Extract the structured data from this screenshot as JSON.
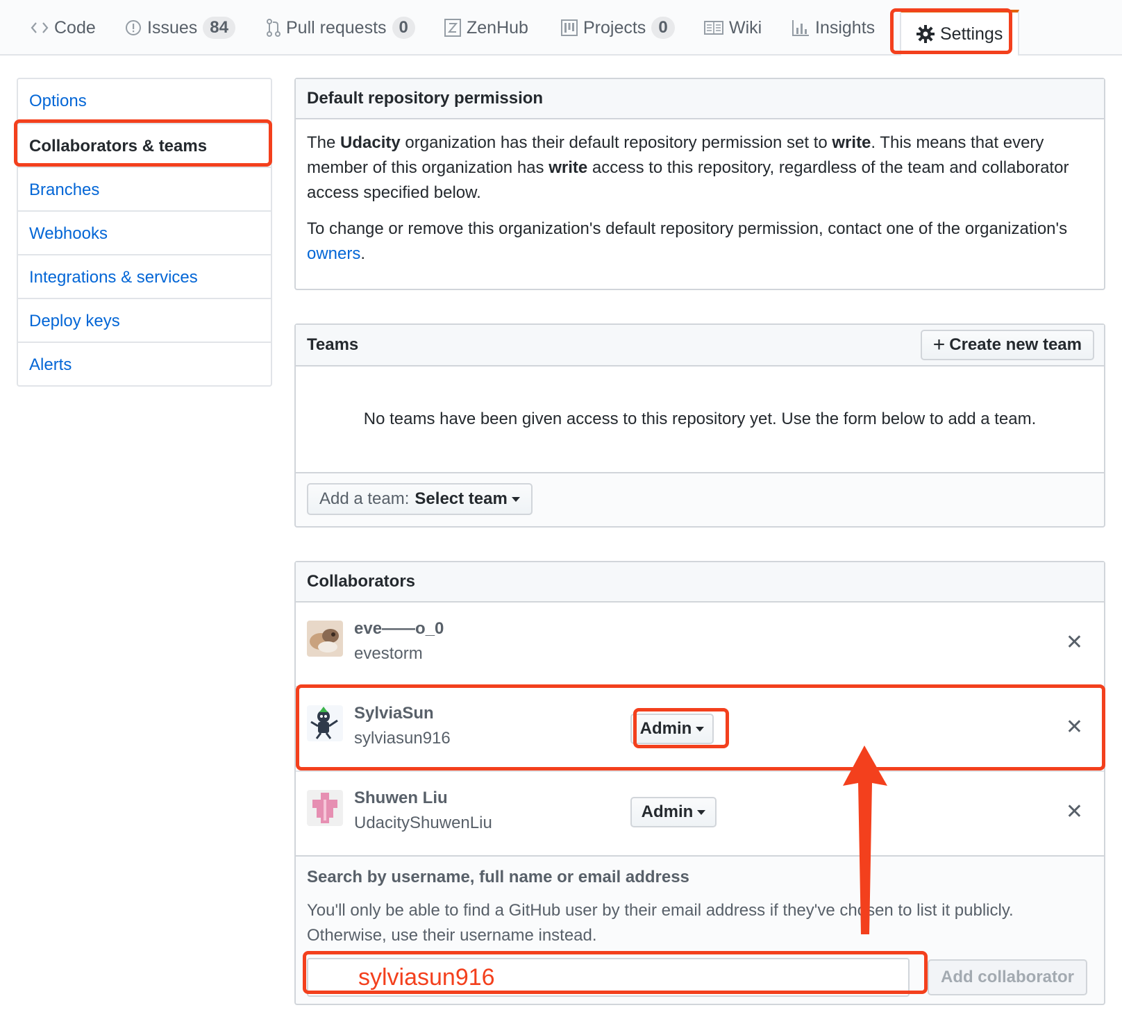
{
  "nav": {
    "tabs": [
      {
        "label": "Code",
        "icon": "code-icon"
      },
      {
        "label": "Issues",
        "icon": "issue-icon",
        "counter": "84"
      },
      {
        "label": "Pull requests",
        "icon": "pull-request-icon",
        "counter": "0"
      },
      {
        "label": "ZenHub",
        "icon": "zenhub-icon"
      },
      {
        "label": "Projects",
        "icon": "project-icon",
        "counter": "0"
      },
      {
        "label": "Wiki",
        "icon": "book-icon"
      },
      {
        "label": "Insights",
        "icon": "graph-icon"
      },
      {
        "label": "Settings",
        "icon": "gear-icon",
        "selected": true
      }
    ]
  },
  "sidebar": {
    "items": [
      {
        "label": "Options"
      },
      {
        "label": "Collaborators & teams",
        "selected": true
      },
      {
        "label": "Branches"
      },
      {
        "label": "Webhooks"
      },
      {
        "label": "Integrations & services"
      },
      {
        "label": "Deploy keys"
      },
      {
        "label": "Alerts"
      }
    ]
  },
  "default_permission": {
    "title": "Default repository permission",
    "p1_a": "The ",
    "org": "Udacity",
    "p1_b": " organization has their default repository permission set to ",
    "perm": "write",
    "p1_c": ". This means that every member of this organization has ",
    "perm2": "write",
    "p1_d": " access to this repository, regardless of the team and collaborator access specified below.",
    "p2_a": "To change or remove this organization's default repository permission, contact one of the organization's ",
    "owners_link": "owners",
    "p2_b": "."
  },
  "teams": {
    "title": "Teams",
    "create_button": "Create new team",
    "empty_message": "No teams have been given access to this repository yet. Use the form below to add a team.",
    "add_team_label": "Add a team:",
    "select_team": "Select team"
  },
  "collaborators": {
    "title": "Collaborators",
    "rows": [
      {
        "name": "eve——o_0",
        "login": "evestorm",
        "role": ""
      },
      {
        "name": "SylviaSun",
        "login": "sylviasun916",
        "role": "Admin"
      },
      {
        "name": "Shuwen Liu",
        "login": "UdacityShuwenLiu",
        "role": "Admin"
      }
    ],
    "search_title": "Search by username, full name or email address",
    "search_help": "You'll only be able to find a GitHub user by their email address if they've chosen to list it publicly. Otherwise, use their username instead.",
    "search_value": "sylviasun916",
    "add_button": "Add collaborator"
  },
  "colors": {
    "highlight": "#f3401d",
    "link": "#0366d6",
    "selected_tab_accent": "#e36209"
  }
}
